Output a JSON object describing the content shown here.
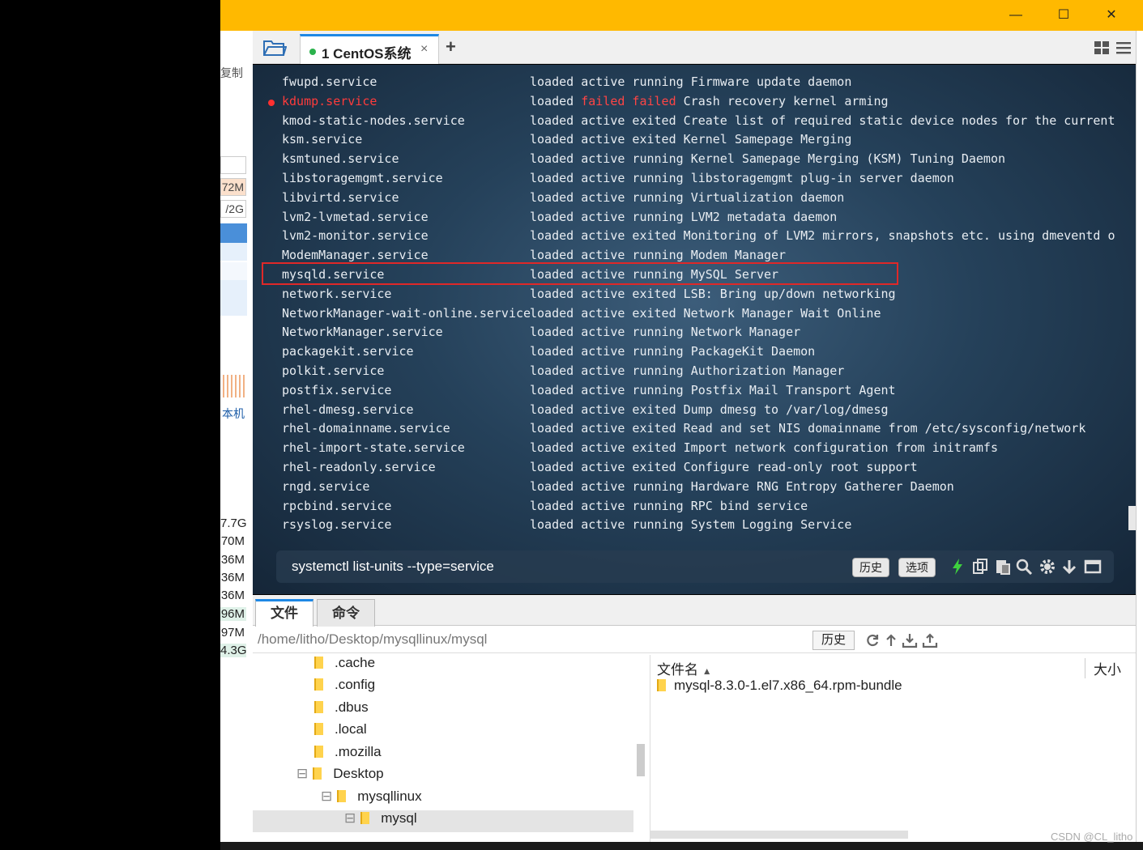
{
  "background_app": {
    "copy_label": "复制",
    "cells": [
      "72M",
      "/2G"
    ],
    "host_label": "本机",
    "mem_values": [
      "7.7G",
      "70M",
      "36M",
      "36M",
      "36M",
      "96M",
      "97M",
      "4.3G"
    ]
  },
  "window": {
    "minimize": "—",
    "maximize": "☐",
    "close": "✕",
    "accent": "#ffb900"
  },
  "tabs": [
    {
      "index": "1",
      "label": "1  CentOS系统",
      "status_color": "#2bb24c"
    }
  ],
  "terminal": {
    "lines": [
      {
        "unit": "fwupd.service",
        "status": "loaded active running",
        "desc": "Firmware update daemon"
      },
      {
        "unit": "kdump.service",
        "status_pre": "loaded ",
        "failed": "failed failed",
        "desc": "Crash recovery kernel arming"
      },
      {
        "unit": "kmod-static-nodes.service",
        "status": "loaded active exited",
        "desc": "Create list of required static device nodes for the current"
      },
      {
        "unit": "ksm.service",
        "status": "loaded active exited",
        "desc": "Kernel Samepage Merging"
      },
      {
        "unit": "ksmtuned.service",
        "status": "loaded active running",
        "desc": "Kernel Samepage Merging (KSM) Tuning Daemon"
      },
      {
        "unit": "libstoragemgmt.service",
        "status": "loaded active running",
        "desc": "libstoragemgmt plug-in server daemon"
      },
      {
        "unit": "libvirtd.service",
        "status": "loaded active running",
        "desc": "Virtualization daemon"
      },
      {
        "unit": "lvm2-lvmetad.service",
        "status": "loaded active running",
        "desc": "LVM2 metadata daemon"
      },
      {
        "unit": "lvm2-monitor.service",
        "status": "loaded active exited",
        "desc": "Monitoring of LVM2 mirrors, snapshots etc. using dmeventd o"
      },
      {
        "unit": "ModemManager.service",
        "status": "loaded active running",
        "desc": "Modem Manager"
      },
      {
        "unit": "mysqld.service",
        "status": "loaded active running",
        "desc": "MySQL Server"
      },
      {
        "unit": "network.service",
        "status": "loaded active exited",
        "desc": "LSB: Bring up/down networking"
      },
      {
        "unit": "NetworkManager-wait-online.service",
        "status": "loaded active exited",
        "desc": "Network Manager Wait Online"
      },
      {
        "unit": "NetworkManager.service",
        "status": "loaded active running",
        "desc": "Network Manager"
      },
      {
        "unit": "packagekit.service",
        "status": "loaded active running",
        "desc": "PackageKit Daemon"
      },
      {
        "unit": "polkit.service",
        "status": "loaded active running",
        "desc": "Authorization Manager"
      },
      {
        "unit": "postfix.service",
        "status": "loaded active running",
        "desc": "Postfix Mail Transport Agent"
      },
      {
        "unit": "rhel-dmesg.service",
        "status": "loaded active exited",
        "desc": "Dump dmesg to /var/log/dmesg"
      },
      {
        "unit": "rhel-domainname.service",
        "status": "loaded active exited",
        "desc": "Read and set NIS domainname from /etc/sysconfig/network"
      },
      {
        "unit": "rhel-import-state.service",
        "status": "loaded active exited",
        "desc": "Import network configuration from initramfs"
      },
      {
        "unit": "rhel-readonly.service",
        "status": "loaded active exited",
        "desc": "Configure read-only root support"
      },
      {
        "unit": "rngd.service",
        "status": "loaded active running",
        "desc": "Hardware RNG Entropy Gatherer Daemon"
      },
      {
        "unit": "rpcbind.service",
        "status": "loaded active running",
        "desc": "RPC bind service"
      },
      {
        "unit": "rsyslog.service",
        "status": "loaded active running",
        "desc": "System Logging Service"
      }
    ],
    "command_input": "systemctl list-units --type=service",
    "history_btn": "历史",
    "options_btn": "选项"
  },
  "bottom_panel": {
    "tabs": [
      "文件",
      "命令"
    ],
    "path": "/home/litho/Desktop/mysqllinux/mysql",
    "history_btn": "历史",
    "tree": [
      ".cache",
      ".config",
      ".dbus",
      ".local",
      ".mozilla",
      "Desktop",
      "mysqllinux",
      "mysql"
    ],
    "files_header": {
      "name": "文件名",
      "size": "大小"
    },
    "files": [
      "mysql-8.3.0-1.el7.x86_64.rpm-bundle"
    ]
  },
  "watermark": "CSDN @CL_litho"
}
